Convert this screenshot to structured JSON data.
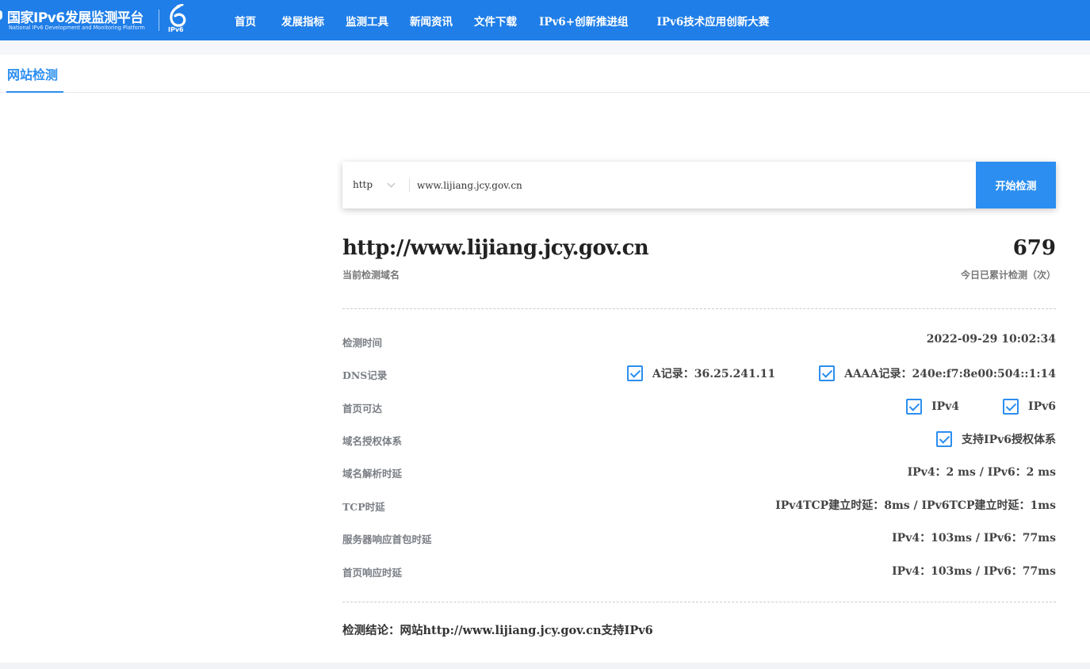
{
  "header": {
    "logo_title": "国家IPv6发展监测平台",
    "logo_subtitle": "National IPv6 Development and Monitoring Platform",
    "logo_mark_label": "IPv6",
    "nav": [
      {
        "label": "首页"
      },
      {
        "label": "发展指标"
      },
      {
        "label": "监测工具"
      },
      {
        "label": "新闻资讯"
      },
      {
        "label": "文件下载"
      },
      {
        "label": "IPv6+创新推进组"
      },
      {
        "label": "IPv6技术应用创新大赛"
      }
    ]
  },
  "tabs": {
    "active": "网站检测"
  },
  "search": {
    "protocol": "http",
    "value": "www.lijiang.jcy.gov.cn",
    "button_label": "开始检测"
  },
  "result": {
    "domain": "http://www.lijiang.jcy.gov.cn",
    "domain_caption": "当前检测域名",
    "count": "679",
    "count_caption": "今日已累计检测（次）",
    "rows": {
      "time": {
        "label": "检测时间",
        "value": "2022-09-29 10:02:34"
      },
      "dns": {
        "label": "DNS记录",
        "a": "A记录：36.25.241.11",
        "aaaa": "AAAA记录：240e:f7:8e00:504::1:14"
      },
      "reach": {
        "label": "首页可达",
        "ipv4": "IPv4",
        "ipv6": "IPv6"
      },
      "auth": {
        "label": "域名授权体系",
        "value": "支持IPv6授权体系"
      },
      "resolve": {
        "label": "域名解析时延",
        "value": "IPv4：2 ms / IPv6：2 ms"
      },
      "tcp": {
        "label": "TCP时延",
        "value": "IPv4TCP建立时延：8ms / IPv6TCP建立时延：1ms"
      },
      "first_packet": {
        "label": "服务器响应首包时延",
        "value": "IPv4：103ms / IPv6：77ms"
      },
      "page_response": {
        "label": "首页响应时延",
        "value": "IPv4：103ms / IPv6：77ms"
      }
    },
    "conclusion": "检测结论：网站http://www.lijiang.jcy.gov.cn支持IPv6"
  },
  "colors": {
    "brand": "#1f7ee8",
    "accent": "#2b8ef0"
  }
}
